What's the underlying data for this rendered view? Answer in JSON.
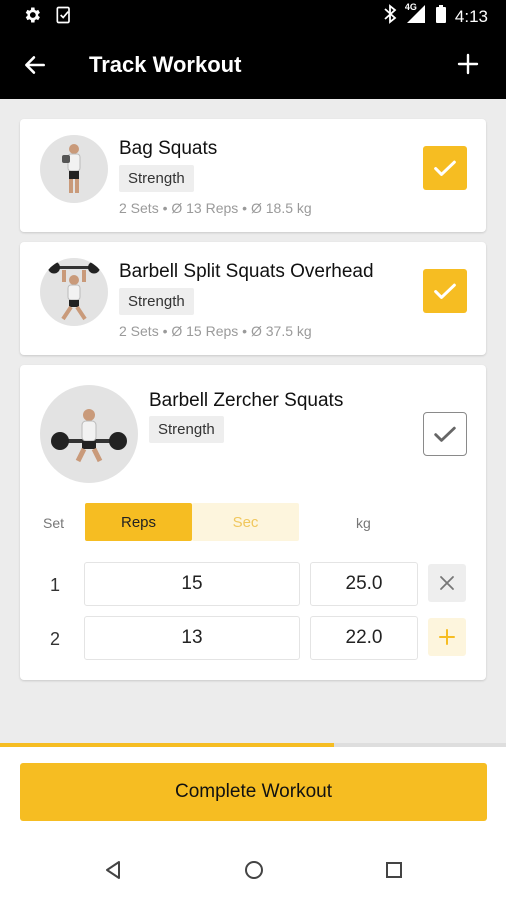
{
  "status_bar": {
    "time": "4:13",
    "network": "4G",
    "icons": [
      "gear-icon",
      "checklist-icon",
      "bluetooth-icon",
      "signal-icon",
      "battery-icon"
    ]
  },
  "app_bar": {
    "title": "Track Workout",
    "back_icon": "arrow-left-icon",
    "add_icon": "plus-icon"
  },
  "exercises": [
    {
      "name": "Bag Squats",
      "category": "Strength",
      "summary": "2 Sets • Ø 13 Reps • Ø 18.5 kg",
      "completed": true
    },
    {
      "name": "Barbell Split Squats Overhead",
      "category": "Strength",
      "summary": "2 Sets • Ø 15 Reps • Ø 37.5 kg",
      "completed": true
    },
    {
      "name": "Barbell Zercher Squats",
      "category": "Strength",
      "completed": false,
      "table": {
        "col_set": "Set",
        "mode_reps": "Reps",
        "mode_sec": "Sec",
        "col_kg": "kg",
        "active_mode": "Reps",
        "rows": [
          {
            "set": "1",
            "reps": "15",
            "kg": "25.0",
            "action": "remove"
          },
          {
            "set": "2",
            "reps": "13",
            "kg": "22.0",
            "action": "add"
          }
        ]
      }
    }
  ],
  "progress": 0.66,
  "complete_button": "Complete Workout",
  "accent_color": "#f6bd22",
  "nav": [
    "back-triangle-icon",
    "home-circle-icon",
    "recents-square-icon"
  ]
}
